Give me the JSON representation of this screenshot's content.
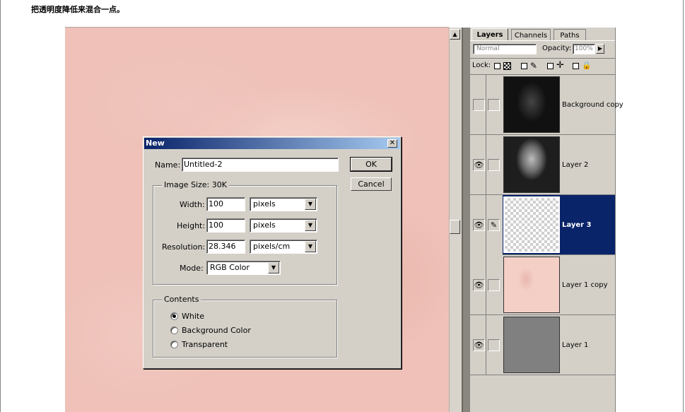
{
  "caption": "把透明度降低来混合一点。",
  "canvas": {
    "scroll_up": "▲"
  },
  "dialog": {
    "title": "New",
    "close": "✕",
    "name_label": "Name:",
    "name_value": "Untitled-2",
    "ok": "OK",
    "cancel": "Cancel",
    "image_size_label": "Image Size: 30K",
    "width_label": "Width:",
    "width_value": "100",
    "width_unit": "pixels",
    "height_label": "Height:",
    "height_value": "100",
    "height_unit": "pixels",
    "resolution_label": "Resolution:",
    "resolution_value": "28.346",
    "resolution_unit": "pixels/cm",
    "mode_label": "Mode:",
    "mode_value": "RGB Color",
    "contents_label": "Contents",
    "contents_options": [
      "White",
      "Background Color",
      "Transparent"
    ],
    "contents_selected": "White"
  },
  "layers_panel": {
    "tabs": [
      "Layers",
      "Channels",
      "Paths"
    ],
    "active_tab": "Layers",
    "blend_mode": "Normal",
    "opacity_label": "Opacity:",
    "opacity_value": "100%",
    "lock_label": "Lock:",
    "layers": [
      {
        "name": "Background copy",
        "visible": false,
        "selected": false
      },
      {
        "name": "Layer 2",
        "visible": true,
        "selected": false
      },
      {
        "name": "Layer 3",
        "visible": true,
        "selected": true
      },
      {
        "name": "Layer 1 copy",
        "visible": true,
        "selected": false
      },
      {
        "name": "Layer 1",
        "visible": true,
        "selected": false
      }
    ]
  },
  "icons": {
    "eye": "eye-icon",
    "brush": "brush-icon",
    "lock_transparency": "lock-transparency-icon",
    "lock_image": "lock-image-icon",
    "lock_position": "lock-position-icon",
    "lock_all": "lock-all-icon"
  },
  "colors": {
    "selection": "#0a246a",
    "canvas_pink": "#efc1b8",
    "dialog_bg": "#d4d0c8"
  }
}
